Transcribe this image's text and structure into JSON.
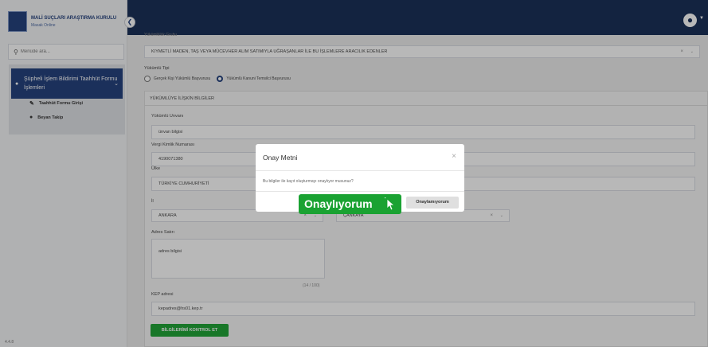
{
  "sidebar": {
    "logo_title": "MALİ SUÇLARI ARAŞTIRMA KURULU",
    "logo_subtitle": "Masak Online",
    "search_placeholder": "Menüde ara...",
    "menu_group_label": "Şüpheli İşlem Bildirimi Taahhüt Formu İşlemleri",
    "items": [
      {
        "label": "Taahhüt Formu Girişi",
        "icon": "pencil-icon"
      },
      {
        "label": "Beyan Takip",
        "icon": "user-icon"
      }
    ],
    "version": "4.4.8"
  },
  "topbar": {
    "avatar_icon": "user-circle-icon"
  },
  "form": {
    "clipped_label": "Yükümlülük Grubu",
    "group_value": "KIYMETLİ MADEN, TAŞ VEYA MÜCEVHER ALIM SATIMIYLA UĞRAŞANLAR İLE BU İŞLEMLERE ARACILIK EDENLER",
    "type_label": "Yükümlü Tipi",
    "type_options": [
      "Gerçek Kişi Yükümlü Başvurusu",
      "Yükümlü Kanuni Temsilci Başvurusu"
    ],
    "panel_title": "YÜKÜMLÜYE İLİŞKİN BİLGİLER",
    "title_label": "Yükümlü Unvanı",
    "title_value": "ünvan bilgisi",
    "tax_label": "Vergi Kimlik Numarası",
    "tax_value": "4190071380",
    "country_label": "Ülke",
    "country_value": "TÜRKİYE CUMHURİYETİ",
    "city_label": "İl",
    "city_value": "ANKARA",
    "district_value": "ÇANKAYA",
    "address_label": "Adres Satırı",
    "address_value": "adres bilgisi",
    "address_counter": "(14 / 100)",
    "kep_label": "KEP adresi",
    "kep_value": "kepadres@hs01.kep.tr",
    "check_button": "BİLGİLERİMİ KONTROL ET"
  },
  "modal": {
    "title": "Onay Metni",
    "body": "Bu bilgiler ile kayıt oluşturmayı onaylıyor musunuz?",
    "confirm_label": "Onaylıyorum",
    "reject_label": "Onaylamıyorum"
  }
}
